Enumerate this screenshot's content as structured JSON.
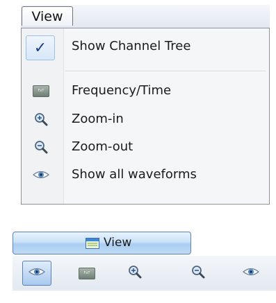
{
  "menubar": {
    "view_label": "View"
  },
  "dropdown": {
    "items": [
      {
        "label": "Show Channel Tree",
        "icon": "checkmark-icon",
        "checked": true
      },
      {
        "label": "Frequency/Time",
        "icon": "frequency-time-icon",
        "icon_text": "FxT"
      },
      {
        "label": "Zoom-in",
        "icon": "zoom-in-icon"
      },
      {
        "label": "Zoom-out",
        "icon": "zoom-out-icon"
      },
      {
        "label": "Show all waveforms",
        "icon": "eye-icon"
      }
    ],
    "check_glyph": "✓"
  },
  "ribbon": {
    "view_label": "View",
    "toolbar": [
      {
        "icon": "eye-icon",
        "active": true
      },
      {
        "icon": "frequency-time-icon",
        "icon_text": "FxT"
      },
      {
        "icon": "zoom-in-icon"
      },
      {
        "icon": "zoom-out-icon"
      },
      {
        "icon": "eye-icon"
      }
    ]
  },
  "colors": {
    "highlight_border": "#9cc0e6",
    "ribbon_button": "#bfdbf6",
    "check_color": "#1d3e86"
  }
}
